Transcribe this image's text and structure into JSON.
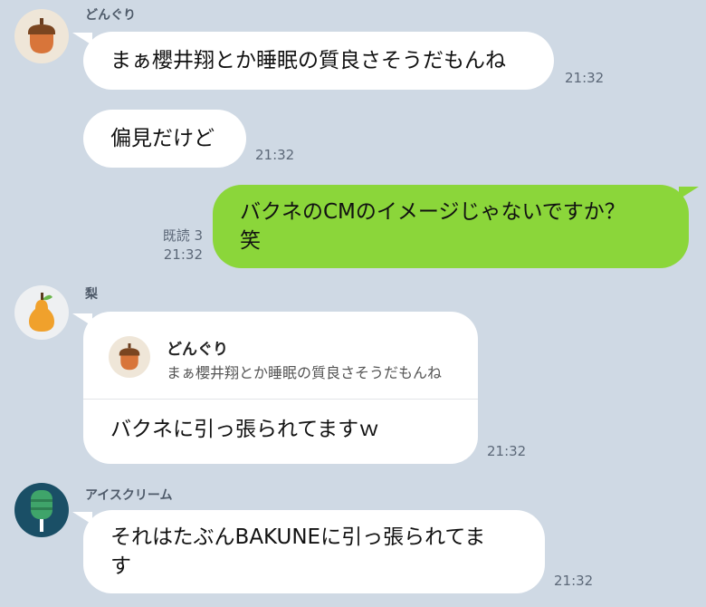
{
  "colors": {
    "background": "#cfd9e4",
    "sent_bubble": "#8bd63a",
    "received_bubble": "#ffffff",
    "meta_text": "#5c6878"
  },
  "messages": [
    {
      "sender": "どんぐり",
      "avatar_icon": "acorn-icon",
      "text": "まぁ櫻井翔とか睡眠の質良さそうだもんね",
      "time": "21:32"
    },
    {
      "text": "偏見だけど",
      "time": "21:32"
    },
    {
      "direction": "sent",
      "text": "バクネのCMのイメージじゃないですか？\n笑",
      "read_status": "既読 3",
      "time": "21:32"
    },
    {
      "sender": "梨",
      "avatar_icon": "pear-icon",
      "quote": {
        "name": "どんぐり",
        "avatar_icon": "acorn-icon",
        "text": "まぁ櫻井翔とか睡眠の質良さそうだもんね"
      },
      "text": "バクネに引っ張られてますｗ",
      "time": "21:32"
    },
    {
      "sender": "アイスクリーム",
      "avatar_icon": "ice-cream-icon",
      "text": "それはたぶんBAKUNEに引っ張られてま\nす",
      "time": "21:32"
    }
  ]
}
